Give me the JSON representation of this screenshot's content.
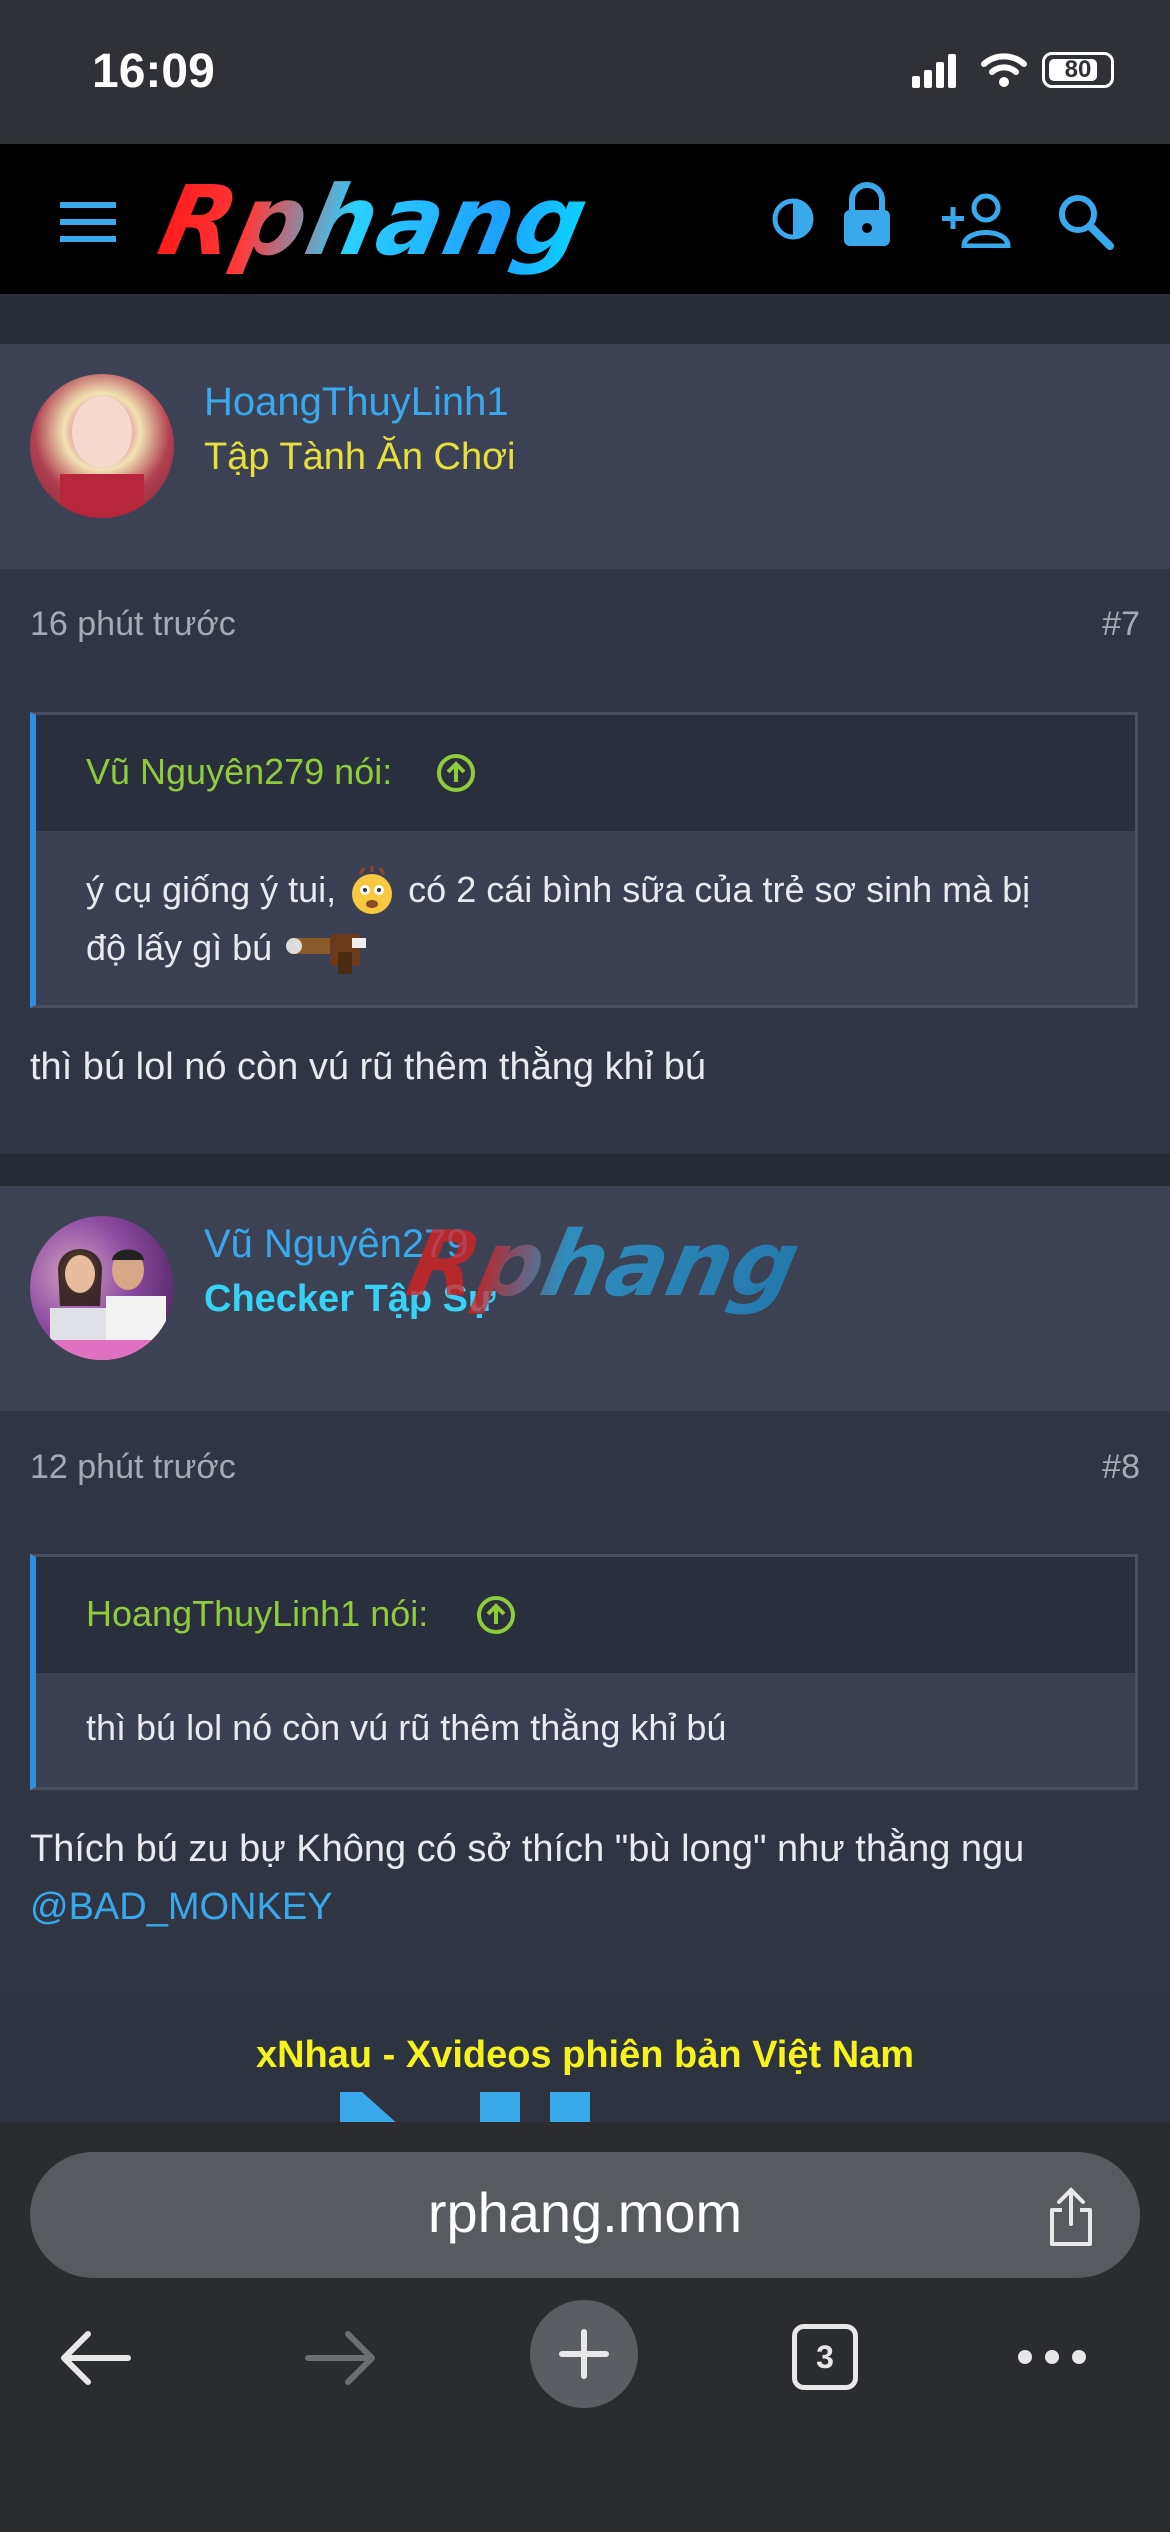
{
  "status_bar": {
    "time": "16:09",
    "battery": "80"
  },
  "header": {
    "logo": "Rphang"
  },
  "posts": [
    {
      "username": "HoangThuyLinh1",
      "user_title": "Tập Tành Ăn Chơi",
      "user_title_color": "#e6e03a",
      "time": "16 phút trước",
      "number": "#7",
      "quote_author": "Vũ Nguyên279 nói:",
      "quote_line1": "ý cụ giống ý tui,",
      "quote_line1b": "có 2 cái bình sữa của trẻ sơ sinh mà bị",
      "quote_line2": "độ lấy gì bú",
      "message": "thì bú lol nó còn vú rũ thêm thằng khỉ bú"
    },
    {
      "username": "Vũ Nguyên279",
      "user_title": "Checker Tập Sự",
      "user_title_color": "#35d3f5",
      "time": "12 phút trước",
      "number": "#8",
      "quote_author": "HoangThuyLinh1 nói:",
      "quote_line1": "thì bú lol nó còn vú rũ thêm thằng khỉ bú",
      "message": "Thích bú zu bự Không có sở thích \"bù long\" như thằng ngu",
      "mention": "@BAD_MONKEY"
    }
  ],
  "watermark": "Rphang",
  "ad": {
    "text": "xNhau - Xvideos phiên bản Việt Nam"
  },
  "browser": {
    "url": "rphang.mom",
    "tab_count": "3"
  }
}
